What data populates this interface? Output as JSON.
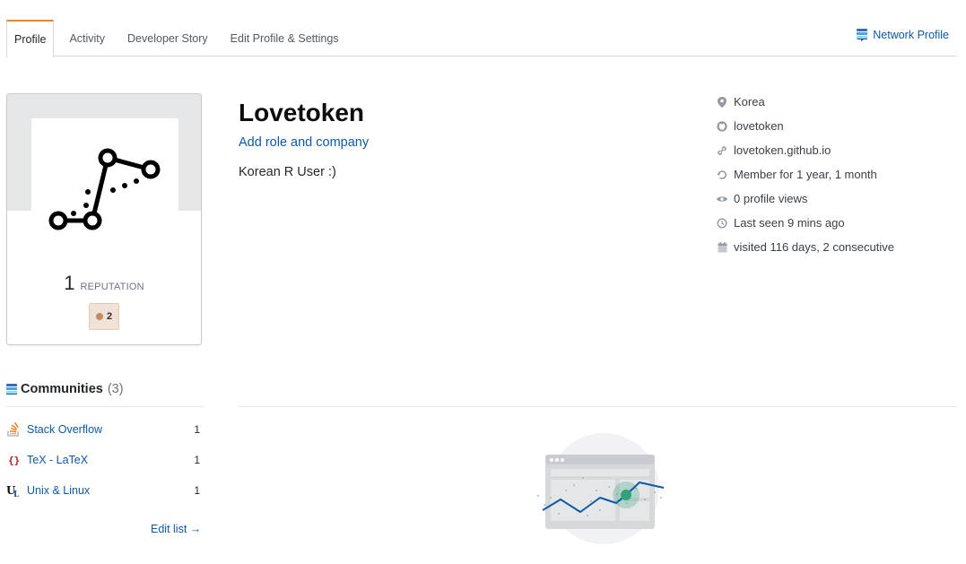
{
  "tabs": [
    {
      "label": "Profile",
      "active": true
    },
    {
      "label": "Activity",
      "active": false
    },
    {
      "label": "Developer Story",
      "active": false
    },
    {
      "label": "Edit Profile & Settings",
      "active": false
    }
  ],
  "network_profile": {
    "label": "Network Profile",
    "icon": "stack-exchange-icon"
  },
  "avatar": {
    "reputation_value": "1",
    "reputation_label": "REPUTATION",
    "bronze_badges": "2"
  },
  "user": {
    "display_name": "Lovetoken",
    "add_role_label": "Add role and company",
    "about": "Korean R User :)"
  },
  "details": [
    {
      "icon": "location-icon",
      "text": "Korea"
    },
    {
      "icon": "github-icon",
      "text": "lovetoken"
    },
    {
      "icon": "link-icon",
      "text": "lovetoken.github.io"
    },
    {
      "icon": "history-icon",
      "text": "Member for 1 year, 1 month"
    },
    {
      "icon": "eye-icon",
      "text": "0 profile views"
    },
    {
      "icon": "clock-icon",
      "text": "Last seen 9 mins ago"
    },
    {
      "icon": "calendar-icon",
      "text": "visited 116 days, 2 consecutive"
    }
  ],
  "communities": {
    "title": "Communities",
    "count": "(3)",
    "items": [
      {
        "name": "Stack Overflow",
        "rep": "1",
        "icon": "stackoverflow-icon"
      },
      {
        "name": "TeX - LaTeX",
        "rep": "1",
        "icon": "tex-icon"
      },
      {
        "name": "Unix & Linux",
        "rep": "1",
        "icon": "unix-linux-icon"
      }
    ],
    "edit_label": "Edit list →"
  },
  "colors": {
    "link": "#0c5aa6",
    "tab_accent": "#f48024",
    "bronze": "#c38b5f",
    "chart_line": "#0c5aa6",
    "chart_highlight": "#2fa37a"
  }
}
